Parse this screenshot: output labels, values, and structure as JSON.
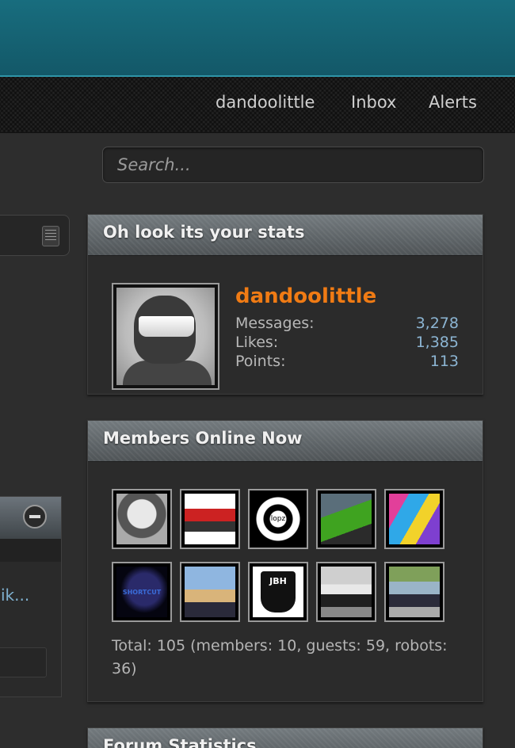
{
  "nav": {
    "username": "dandoolittle",
    "inbox": "Inbox",
    "alerts": "Alerts"
  },
  "search": {
    "placeholder": "Search..."
  },
  "left_text": "ik...",
  "stats": {
    "title": "Oh look its your stats",
    "username": "dandoolittle",
    "messages_label": "Messages:",
    "messages_value": "3,278",
    "likes_label": "Likes:",
    "likes_value": "1,385",
    "points_label": "Points:",
    "points_value": "113"
  },
  "members_online": {
    "title": "Members Online Now",
    "avatars": [
      "helmet-avatar",
      "red-motorcycle-avatar",
      "gear-logo-avatar",
      "green-motorcycle-avatar",
      "graffiti-avatar",
      "dark-logo-avatar",
      "dog-avatar",
      "jbh-logo-avatar",
      "white-motorcycle-avatar",
      "rider-avatar"
    ],
    "mini_text": {
      "gear_logo": "lopz",
      "dark_logo": "SHORTCUT",
      "jbh_logo": "JBH"
    },
    "total": "Total: 105 (members: 10, guests: 59, robots: 36)"
  },
  "forum_statistics": {
    "title": "Forum Statistics"
  },
  "colors": {
    "header": "#186d7e",
    "username_orange": "#f07b14",
    "stat_value_blue": "#8cb5d3"
  }
}
